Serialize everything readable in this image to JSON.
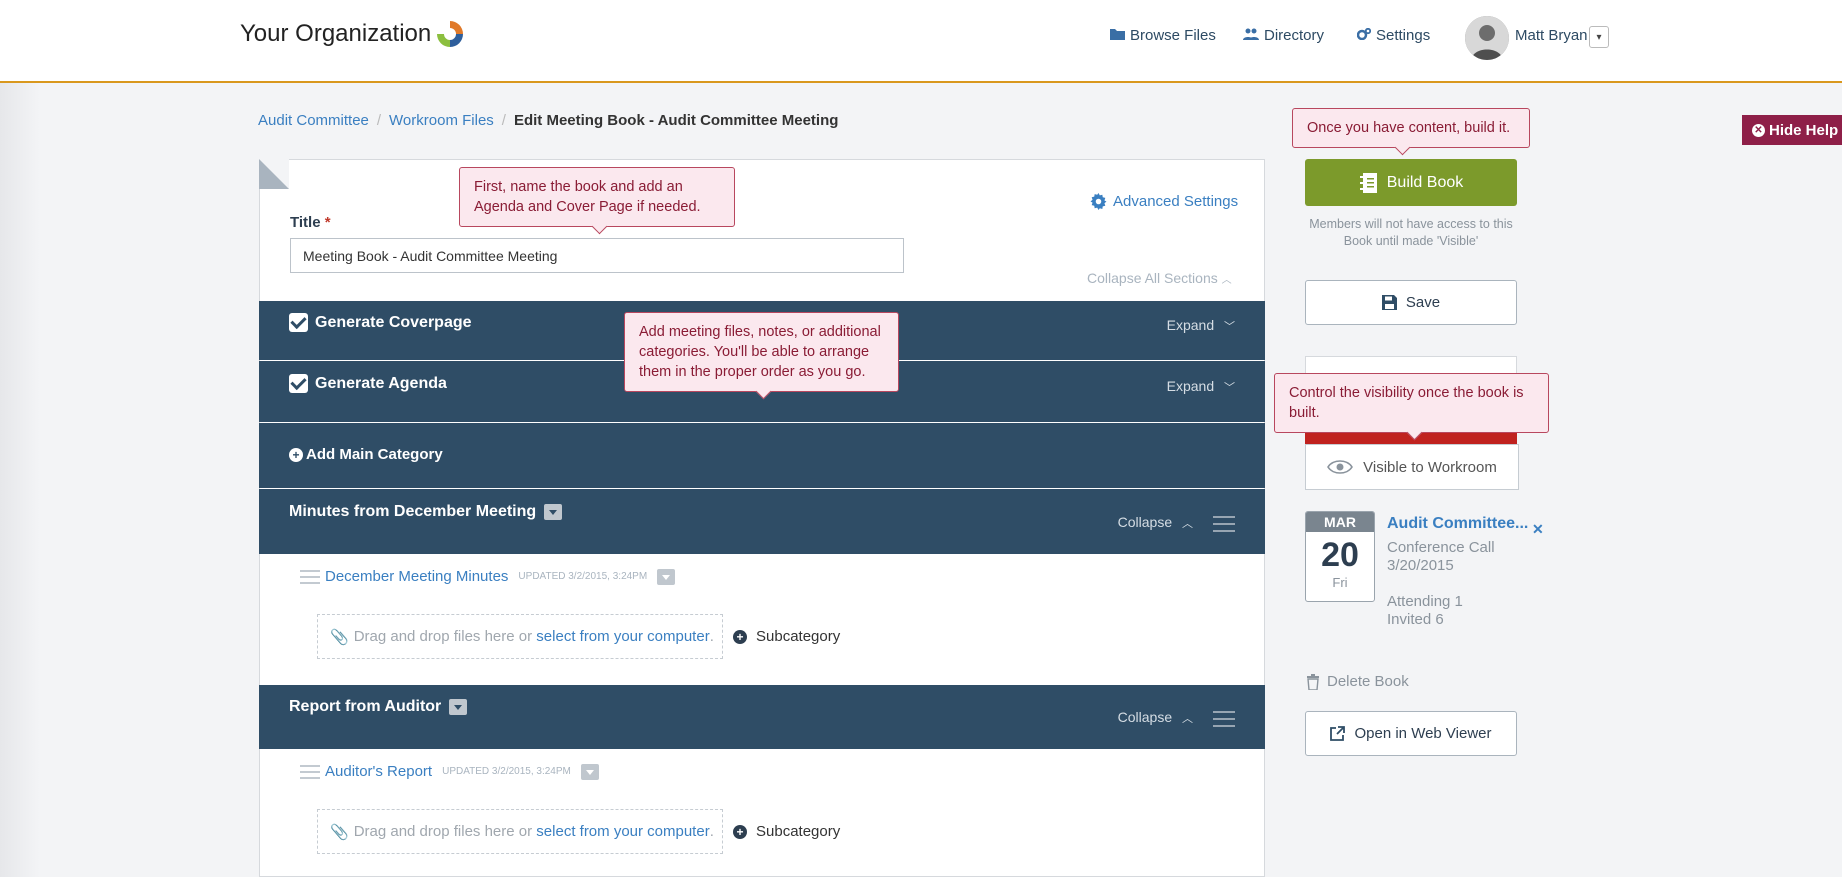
{
  "app": {
    "org_name": "Your Organization"
  },
  "nav": {
    "browse_files": "Browse Files",
    "directory": "Directory",
    "settings": "Settings",
    "user_name": "Matt Bryan"
  },
  "breadcrumb": {
    "items": [
      "Audit Committee",
      "Workroom Files"
    ],
    "current": "Edit Meeting Book - Audit Committee Meeting"
  },
  "form": {
    "title_label": "Title",
    "required_mark": "*",
    "title_value": "Meeting Book - Audit Committee Meeting",
    "advanced_settings": "Advanced Settings",
    "collapse_all": "Collapse All Sections"
  },
  "sections": {
    "coverpage": {
      "label": "Generate Coverpage",
      "action": "Expand"
    },
    "agenda": {
      "label": "Generate Agenda",
      "action": "Expand"
    },
    "add_main": {
      "label": "Add Main Category"
    },
    "categories": [
      {
        "name": "Minutes from December Meeting",
        "action": "Collapse",
        "file": "December Meeting Minutes",
        "updated": "UPDATED 3/2/2015, 3:24PM"
      },
      {
        "name": "Report from Auditor",
        "action": "Collapse",
        "file": "Auditor's Report",
        "updated": "UPDATED 3/2/2015, 3:24PM"
      }
    ],
    "drop_text": "Drag and drop files here or",
    "drop_link": "select from your computer",
    "drop_end": ".",
    "subcategory": "Subcategory"
  },
  "sidebar": {
    "build_book": "Build Book",
    "members_note": "Members will not have access to this Book until made 'Visible'",
    "save": "Save",
    "visible": "Visible to Workroom",
    "event": {
      "month": "MAR",
      "day": "20",
      "weekday": "Fri",
      "title": "Audit Committee...",
      "type": "Conference Call",
      "date": "3/20/2015",
      "attending": "Attending 1",
      "invited": "Invited 6"
    },
    "delete_book": "Delete Book",
    "open_web_viewer": "Open in Web Viewer"
  },
  "help": {
    "hide_help": "Hide Help",
    "tip_build": "Once you have content, build it.",
    "tip_name": "First, name the book and add an Agenda and Cover Page if needed.",
    "tip_files": "Add meeting files, notes, or additional categories. You'll be able to arrange them in the proper order as you go.",
    "tip_visibility": "Control the visibility once the book is built."
  },
  "colors": {
    "accent": "#d9981e",
    "bar": "#2f4d66",
    "build": "#7c9a2b",
    "help": "#8e1f48",
    "link": "#3a7fc1"
  }
}
